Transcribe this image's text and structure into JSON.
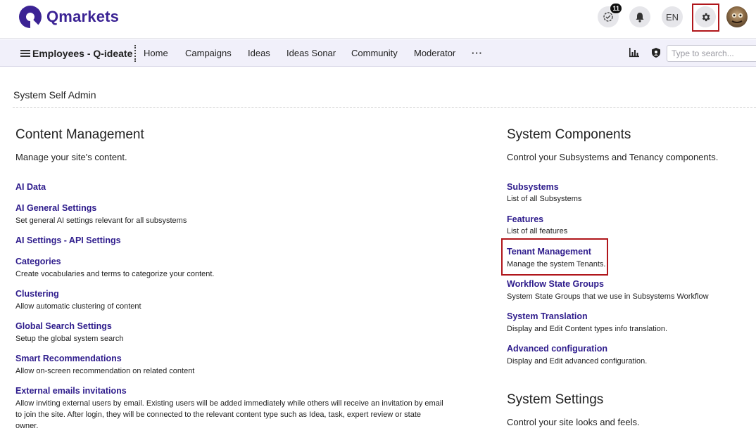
{
  "brand": {
    "name": "Qmarkets"
  },
  "header": {
    "notifications_count": "11",
    "language": "EN",
    "icons": [
      "activity-icon",
      "bell-icon",
      "gear-icon"
    ]
  },
  "nav": {
    "workspace": "Employees - Q-ideate",
    "items": [
      "Home",
      "Campaigns",
      "Ideas",
      "Ideas Sonar",
      "Community",
      "Moderator"
    ],
    "more": "···",
    "search_placeholder": "Type to search..."
  },
  "page": {
    "title": "System Self Admin"
  },
  "content_management": {
    "heading": "Content Management",
    "description": "Manage your site's content.",
    "links": [
      {
        "title": "AI Data",
        "desc": ""
      },
      {
        "title": "AI General Settings",
        "desc": "Set general AI settings relevant for all subsystems"
      },
      {
        "title": "AI Settings - API Settings",
        "desc": ""
      },
      {
        "title": "Categories",
        "desc": "Create vocabularies and terms to categorize your content."
      },
      {
        "title": "Clustering",
        "desc": "Allow automatic clustering of content"
      },
      {
        "title": "Global Search Settings",
        "desc": "Setup the global system search"
      },
      {
        "title": "Smart Recommendations",
        "desc": "Allow on-screen recommendation on related content"
      },
      {
        "title": "External emails invitations",
        "desc": "Allow inviting external users by email. Existing users will be added immediately while others will receive an invitation by email to join the site. After login, they will be connected to the relevant content type such as Idea, task, expert review or state owner."
      }
    ]
  },
  "system_components": {
    "heading": "System Components",
    "description": "Control your Subsystems and Tenancy components.",
    "links": [
      {
        "title": "Subsystems",
        "desc": "List of all Subsystems"
      },
      {
        "title": "Features",
        "desc": "List of all features"
      },
      {
        "title": "Tenant Management",
        "desc": "Manage the system Tenants."
      },
      {
        "title": "Workflow State Groups",
        "desc": "System State Groups that we use in Subsystems Workflow"
      },
      {
        "title": "System Translation",
        "desc": "Display and Edit Content types info translation."
      },
      {
        "title": "Advanced configuration",
        "desc": "Display and Edit advanced configuration."
      }
    ]
  },
  "system_settings": {
    "heading": "System Settings",
    "description": "Control your site looks and feels."
  },
  "colors": {
    "brand": "#3b2394",
    "link": "#2e1c8c",
    "highlight": "#b0161b",
    "nav_bg": "#f1f0fa"
  }
}
